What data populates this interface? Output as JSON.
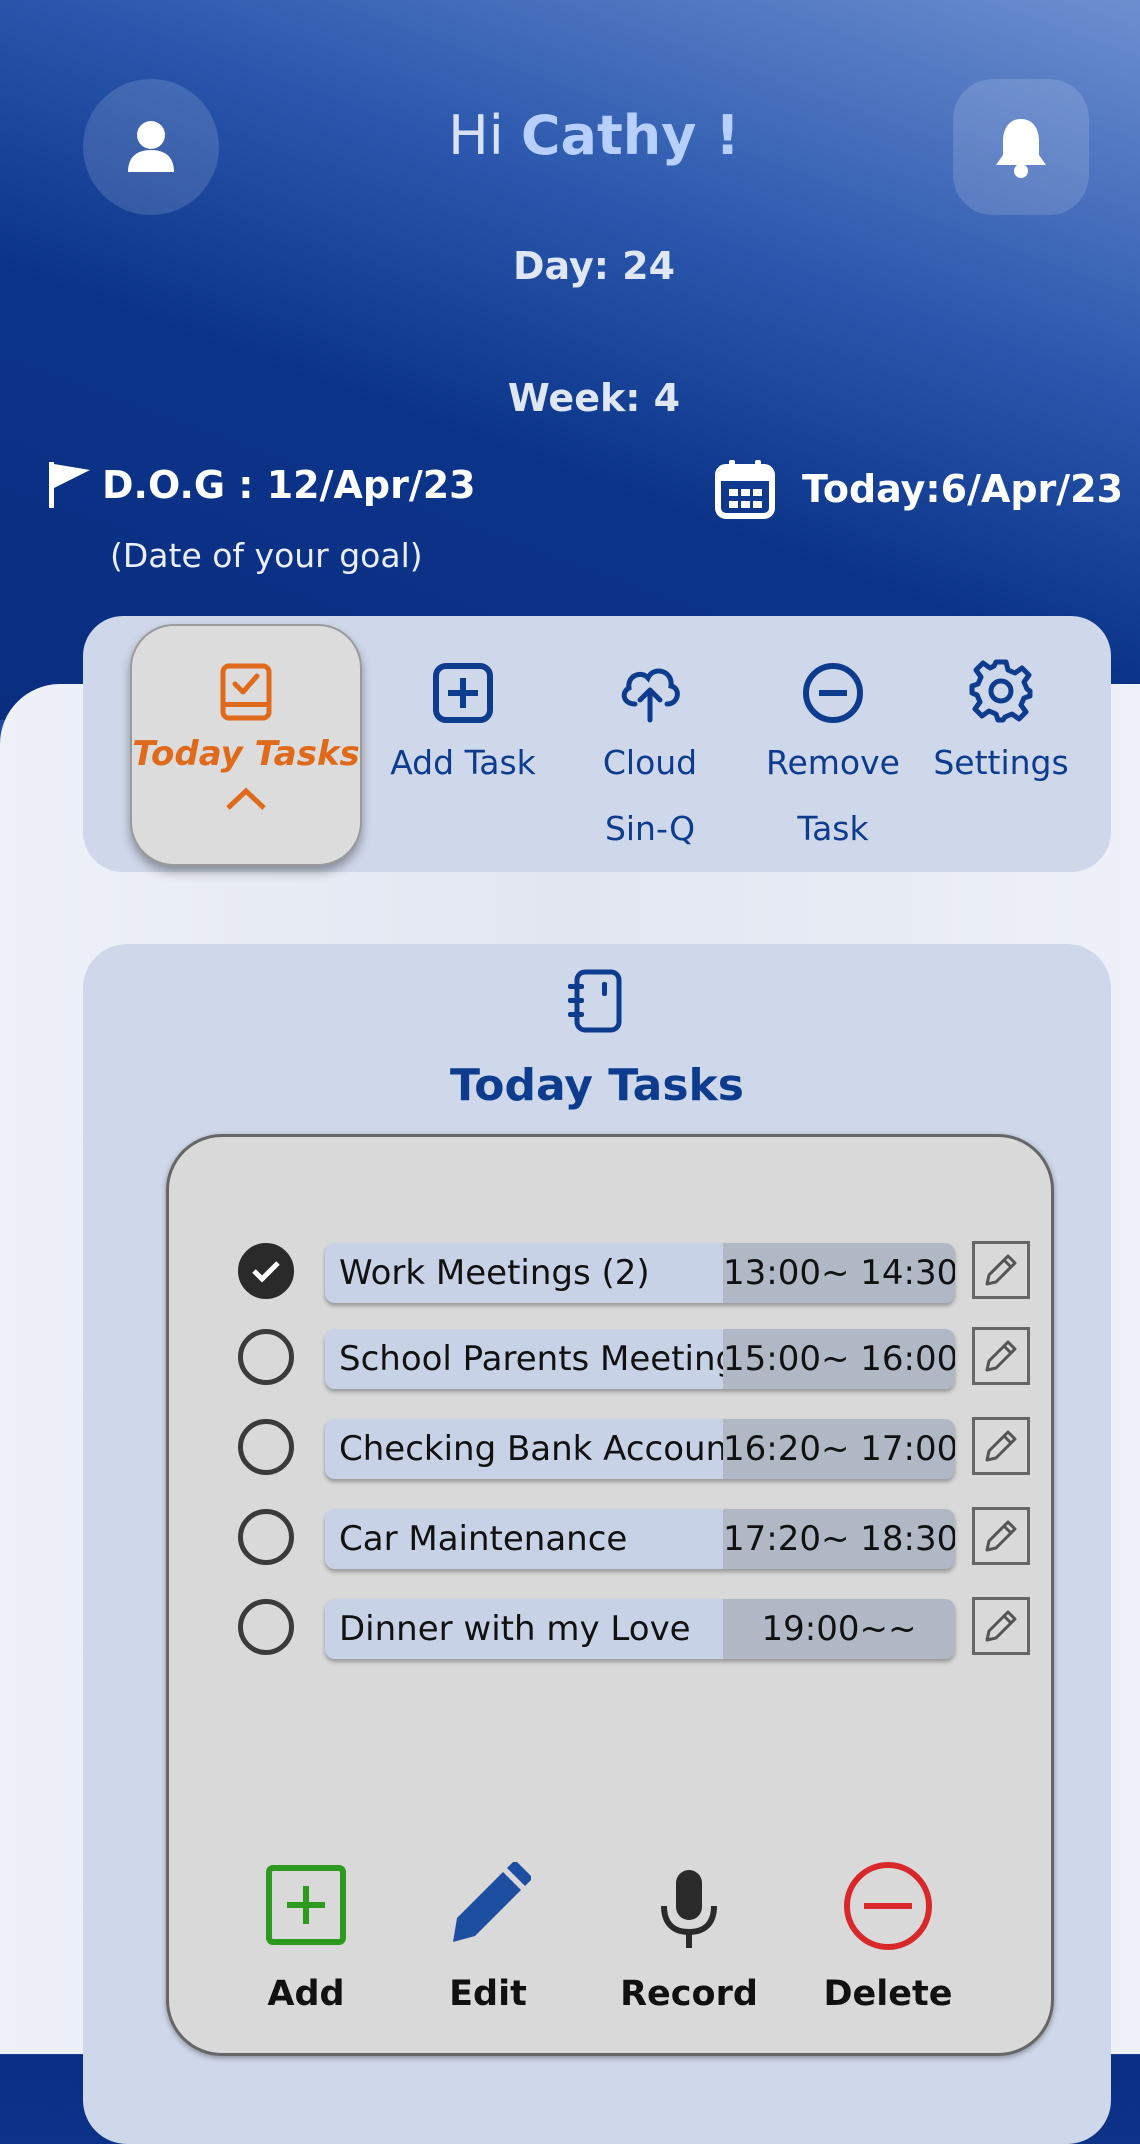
{
  "header": {
    "greeting_prefix": "Hi",
    "user_name": "Cathy !",
    "day": "Day: 24",
    "week": "Week: 4",
    "goal_date": "D.O.G : 12/Apr/23",
    "goal_date_note": "(Date of your goal)",
    "today_date": "Today:6/Apr/23"
  },
  "toolbar": {
    "items": [
      {
        "label": "Today Tasks",
        "icon": "task-board-icon",
        "active": true
      },
      {
        "label": "Add Task",
        "icon": "plus-square-icon"
      },
      {
        "label": "Cloud Sin-Q",
        "line1": "Cloud",
        "line2": "Sin-Q",
        "icon": "cloud-upload-icon"
      },
      {
        "label": "Remove Task",
        "line1": "Remove",
        "line2": "Task",
        "icon": "minus-circle-icon"
      },
      {
        "label": "Settings",
        "icon": "gear-icon"
      }
    ]
  },
  "tasks_card": {
    "title": "Today Tasks",
    "tasks": [
      {
        "name": "Work Meetings (2)",
        "time": "13:00~ 14:30",
        "done": true
      },
      {
        "name": "School Parents Meeting",
        "time": "15:00~ 16:00",
        "done": false
      },
      {
        "name": "Checking Bank Account",
        "time": "16:20~ 17:00",
        "done": false
      },
      {
        "name": "Car Maintenance",
        "time": "17:20~ 18:30",
        "done": false
      },
      {
        "name": "Dinner with my Love",
        "time": "19:00~~",
        "done": false
      }
    ],
    "actions": [
      {
        "label": "Add",
        "icon": "add-square-icon"
      },
      {
        "label": "Edit",
        "icon": "pencil-icon"
      },
      {
        "label": "Record",
        "icon": "microphone-icon"
      },
      {
        "label": "Delete",
        "icon": "delete-circle-icon"
      }
    ]
  },
  "colors": {
    "accent_blue": "#0d3c8f",
    "active_orange": "#e06a1b",
    "add_green": "#2d9a1f",
    "delete_red": "#d8282a"
  }
}
